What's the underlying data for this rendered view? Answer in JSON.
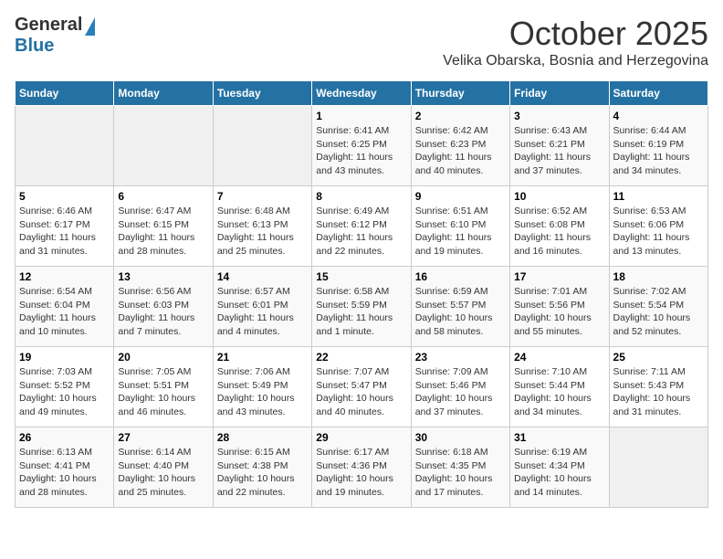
{
  "header": {
    "logo": {
      "general": "General",
      "blue": "Blue"
    },
    "title": "October 2025",
    "location": "Velika Obarska, Bosnia and Herzegovina"
  },
  "calendar": {
    "days_of_week": [
      "Sunday",
      "Monday",
      "Tuesday",
      "Wednesday",
      "Thursday",
      "Friday",
      "Saturday"
    ],
    "weeks": [
      [
        {
          "day": null,
          "info": null
        },
        {
          "day": null,
          "info": null
        },
        {
          "day": null,
          "info": null
        },
        {
          "day": "1",
          "info": "Sunrise: 6:41 AM\nSunset: 6:25 PM\nDaylight: 11 hours\nand 43 minutes."
        },
        {
          "day": "2",
          "info": "Sunrise: 6:42 AM\nSunset: 6:23 PM\nDaylight: 11 hours\nand 40 minutes."
        },
        {
          "day": "3",
          "info": "Sunrise: 6:43 AM\nSunset: 6:21 PM\nDaylight: 11 hours\nand 37 minutes."
        },
        {
          "day": "4",
          "info": "Sunrise: 6:44 AM\nSunset: 6:19 PM\nDaylight: 11 hours\nand 34 minutes."
        }
      ],
      [
        {
          "day": "5",
          "info": "Sunrise: 6:46 AM\nSunset: 6:17 PM\nDaylight: 11 hours\nand 31 minutes."
        },
        {
          "day": "6",
          "info": "Sunrise: 6:47 AM\nSunset: 6:15 PM\nDaylight: 11 hours\nand 28 minutes."
        },
        {
          "day": "7",
          "info": "Sunrise: 6:48 AM\nSunset: 6:13 PM\nDaylight: 11 hours\nand 25 minutes."
        },
        {
          "day": "8",
          "info": "Sunrise: 6:49 AM\nSunset: 6:12 PM\nDaylight: 11 hours\nand 22 minutes."
        },
        {
          "day": "9",
          "info": "Sunrise: 6:51 AM\nSunset: 6:10 PM\nDaylight: 11 hours\nand 19 minutes."
        },
        {
          "day": "10",
          "info": "Sunrise: 6:52 AM\nSunset: 6:08 PM\nDaylight: 11 hours\nand 16 minutes."
        },
        {
          "day": "11",
          "info": "Sunrise: 6:53 AM\nSunset: 6:06 PM\nDaylight: 11 hours\nand 13 minutes."
        }
      ],
      [
        {
          "day": "12",
          "info": "Sunrise: 6:54 AM\nSunset: 6:04 PM\nDaylight: 11 hours\nand 10 minutes."
        },
        {
          "day": "13",
          "info": "Sunrise: 6:56 AM\nSunset: 6:03 PM\nDaylight: 11 hours\nand 7 minutes."
        },
        {
          "day": "14",
          "info": "Sunrise: 6:57 AM\nSunset: 6:01 PM\nDaylight: 11 hours\nand 4 minutes."
        },
        {
          "day": "15",
          "info": "Sunrise: 6:58 AM\nSunset: 5:59 PM\nDaylight: 11 hours\nand 1 minute."
        },
        {
          "day": "16",
          "info": "Sunrise: 6:59 AM\nSunset: 5:57 PM\nDaylight: 10 hours\nand 58 minutes."
        },
        {
          "day": "17",
          "info": "Sunrise: 7:01 AM\nSunset: 5:56 PM\nDaylight: 10 hours\nand 55 minutes."
        },
        {
          "day": "18",
          "info": "Sunrise: 7:02 AM\nSunset: 5:54 PM\nDaylight: 10 hours\nand 52 minutes."
        }
      ],
      [
        {
          "day": "19",
          "info": "Sunrise: 7:03 AM\nSunset: 5:52 PM\nDaylight: 10 hours\nand 49 minutes."
        },
        {
          "day": "20",
          "info": "Sunrise: 7:05 AM\nSunset: 5:51 PM\nDaylight: 10 hours\nand 46 minutes."
        },
        {
          "day": "21",
          "info": "Sunrise: 7:06 AM\nSunset: 5:49 PM\nDaylight: 10 hours\nand 43 minutes."
        },
        {
          "day": "22",
          "info": "Sunrise: 7:07 AM\nSunset: 5:47 PM\nDaylight: 10 hours\nand 40 minutes."
        },
        {
          "day": "23",
          "info": "Sunrise: 7:09 AM\nSunset: 5:46 PM\nDaylight: 10 hours\nand 37 minutes."
        },
        {
          "day": "24",
          "info": "Sunrise: 7:10 AM\nSunset: 5:44 PM\nDaylight: 10 hours\nand 34 minutes."
        },
        {
          "day": "25",
          "info": "Sunrise: 7:11 AM\nSunset: 5:43 PM\nDaylight: 10 hours\nand 31 minutes."
        }
      ],
      [
        {
          "day": "26",
          "info": "Sunrise: 6:13 AM\nSunset: 4:41 PM\nDaylight: 10 hours\nand 28 minutes."
        },
        {
          "day": "27",
          "info": "Sunrise: 6:14 AM\nSunset: 4:40 PM\nDaylight: 10 hours\nand 25 minutes."
        },
        {
          "day": "28",
          "info": "Sunrise: 6:15 AM\nSunset: 4:38 PM\nDaylight: 10 hours\nand 22 minutes."
        },
        {
          "day": "29",
          "info": "Sunrise: 6:17 AM\nSunset: 4:36 PM\nDaylight: 10 hours\nand 19 minutes."
        },
        {
          "day": "30",
          "info": "Sunrise: 6:18 AM\nSunset: 4:35 PM\nDaylight: 10 hours\nand 17 minutes."
        },
        {
          "day": "31",
          "info": "Sunrise: 6:19 AM\nSunset: 4:34 PM\nDaylight: 10 hours\nand 14 minutes."
        },
        {
          "day": null,
          "info": null
        }
      ]
    ]
  }
}
